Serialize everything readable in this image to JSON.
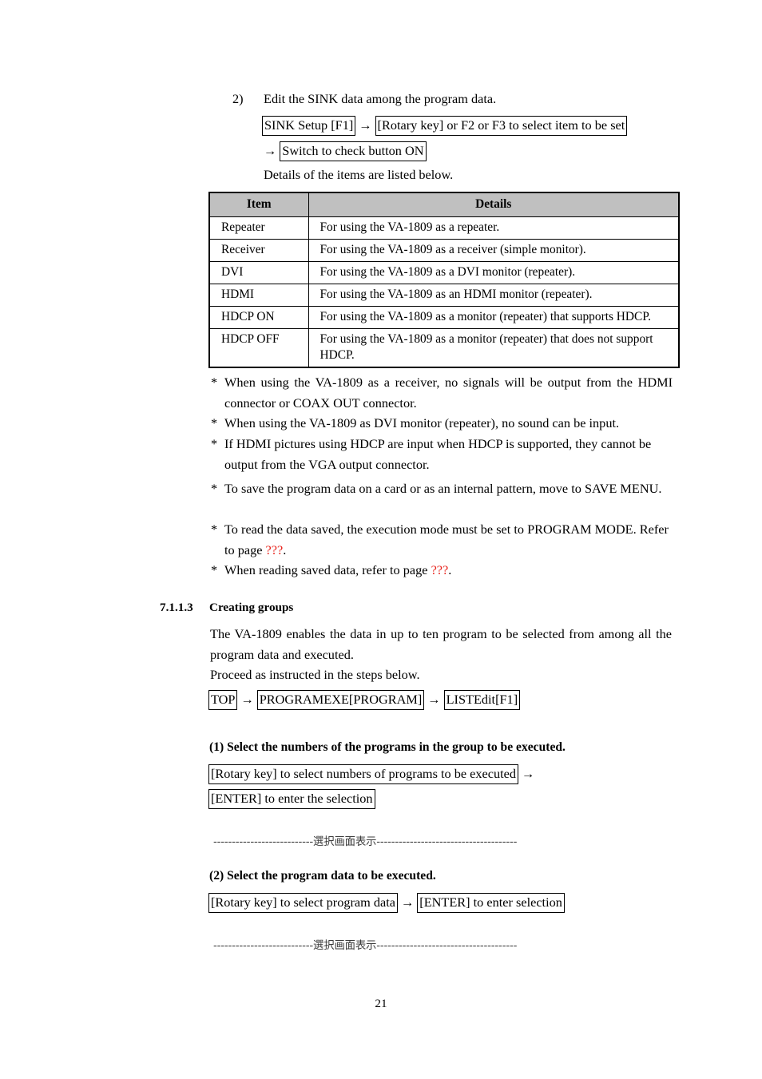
{
  "document": {
    "page_number": "21"
  },
  "step2": {
    "marker": "2)",
    "text": "Edit the SINK data among the program data.",
    "sequence_line1": {
      "chip1": "SINK Setup [F1]",
      "arrow1": "→",
      "chip2": "[Rotary key] or F2 or F3 to select item to be set"
    },
    "sequence_line2": {
      "arrow": "→",
      "chip": "Switch to check button ON"
    },
    "details_intro": "Details of the items are listed below."
  },
  "table": {
    "headers": [
      "Item",
      "Details"
    ],
    "rows": [
      {
        "item": "Repeater",
        "details": "For using the VA-1809 as a repeater."
      },
      {
        "item": "Receiver",
        "details": "For using the VA-1809 as a receiver (simple monitor)."
      },
      {
        "item": "DVI",
        "details": "For using the VA-1809 as a DVI monitor (repeater)."
      },
      {
        "item": "HDMI",
        "details": "For using the VA-1809 as an HDMI monitor (repeater)."
      },
      {
        "item": "HDCP ON",
        "details": "For using the VA-1809 as a monitor (repeater) that supports HDCP."
      },
      {
        "item": "HDCP OFF",
        "details": "For using the VA-1809 as a monitor (repeater) that does not support HDCP."
      }
    ],
    "header_background": "#c0c0c0"
  },
  "notes": {
    "marker": "*",
    "items": [
      {
        "text": "When using the VA-1809 as a receiver, no signals will be output from the HDMI connector or COAX OUT connector."
      },
      {
        "text": "When using the VA-1809 as DVI monitor (repeater), no sound can be input."
      },
      {
        "text": "If HDMI pictures using HDCP are input when HDCP is supported, they cannot be output from the VGA output connector."
      },
      {
        "text": "To save the program data on a card or as an internal pattern, move to SAVE MENU."
      },
      {
        "prefix": "To read the data saved, the execution mode must be set to PROGRAM MODE. Refer to page ",
        "ref": "???",
        "suffix": "."
      },
      {
        "prefix": "When reading saved data, refer to page ",
        "ref": "???",
        "suffix": "."
      }
    ],
    "reference_color": "#e8211a"
  },
  "section": {
    "number": "7.1.1.3",
    "title": "Creating groups",
    "paragraph1": "The VA-1809 enables the data in up to ten program to be selected from among all the program data and executed.",
    "paragraph2": "Proceed as instructed in the steps below.",
    "nav_path": {
      "chip1": "TOP",
      "arrow1": "→",
      "chip2": "PROGRAMEXE[PROGRAM]",
      "arrow2": "→",
      "chip3": "LISTEdit[F1]"
    }
  },
  "step1": {
    "heading": "(1)  Select the numbers of the programs in the group to be executed.",
    "chip1": "[Rotary key] to select numbers of programs to be executed",
    "arrow1": "→",
    "chip2": "[ENTER] to enter the selection",
    "separator": "---------------------------選択画面表示--------------------------------------"
  },
  "step2b": {
    "heading": "(2)  Select the program data to be executed.",
    "chip1": "[Rotary key] to select program data",
    "arrow1": "→",
    "chip2": "[ENTER] to enter selection",
    "separator": "---------------------------選択画面表示--------------------------------------"
  }
}
